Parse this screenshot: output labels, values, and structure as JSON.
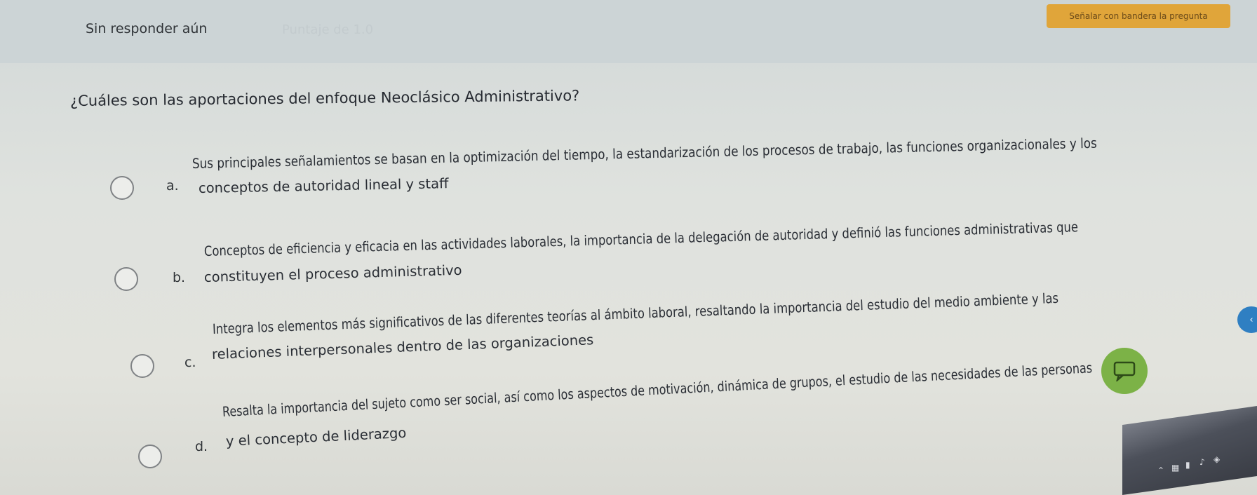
{
  "header": {
    "status": "Sin responder aún",
    "points": "Puntaje de 1.0",
    "flag_label": "Señalar con bandera la pregunta"
  },
  "question": {
    "text": "¿Cuáles son las aportaciones del enfoque Neoclásico Administrativo?"
  },
  "options": [
    {
      "letter": "a.",
      "line1": "Sus principales señalamientos se basan en la optimización del tiempo, la estandarización de los procesos de trabajo, las funciones organizacionales y los",
      "line2": "conceptos de autoridad lineal y staff"
    },
    {
      "letter": "b.",
      "line1": "Conceptos de eficiencia y eficacia en las actividades laborales, la importancia de la delegación de autoridad y definió las funciones administrativas que",
      "line2": "constituyen el proceso administrativo"
    },
    {
      "letter": "c.",
      "line1": "Integra los elementos más significativos de las diferentes teorías al ámbito laboral, resaltando la importancia del estudio del medio ambiente y las",
      "line2": "relaciones interpersonales dentro de las organizaciones"
    },
    {
      "letter": "d.",
      "line1": "Resalta la importancia del sujeto como ser social, así como los aspectos de motivación, dinámica de grupos, el estudio de las necesidades de las personas",
      "line2": "y el concepto de liderazgo"
    }
  ],
  "icons": {
    "radio": "radio-circle-icon",
    "chat": "chat-icon",
    "tray": [
      "chevron-up-icon",
      "app-icon",
      "battery-icon",
      "volume-icon",
      "language-icon"
    ]
  },
  "colors": {
    "flag_button": "#e0a53a",
    "chat_bubble": "#7cb247",
    "side_bubble": "#2f7fc2"
  }
}
